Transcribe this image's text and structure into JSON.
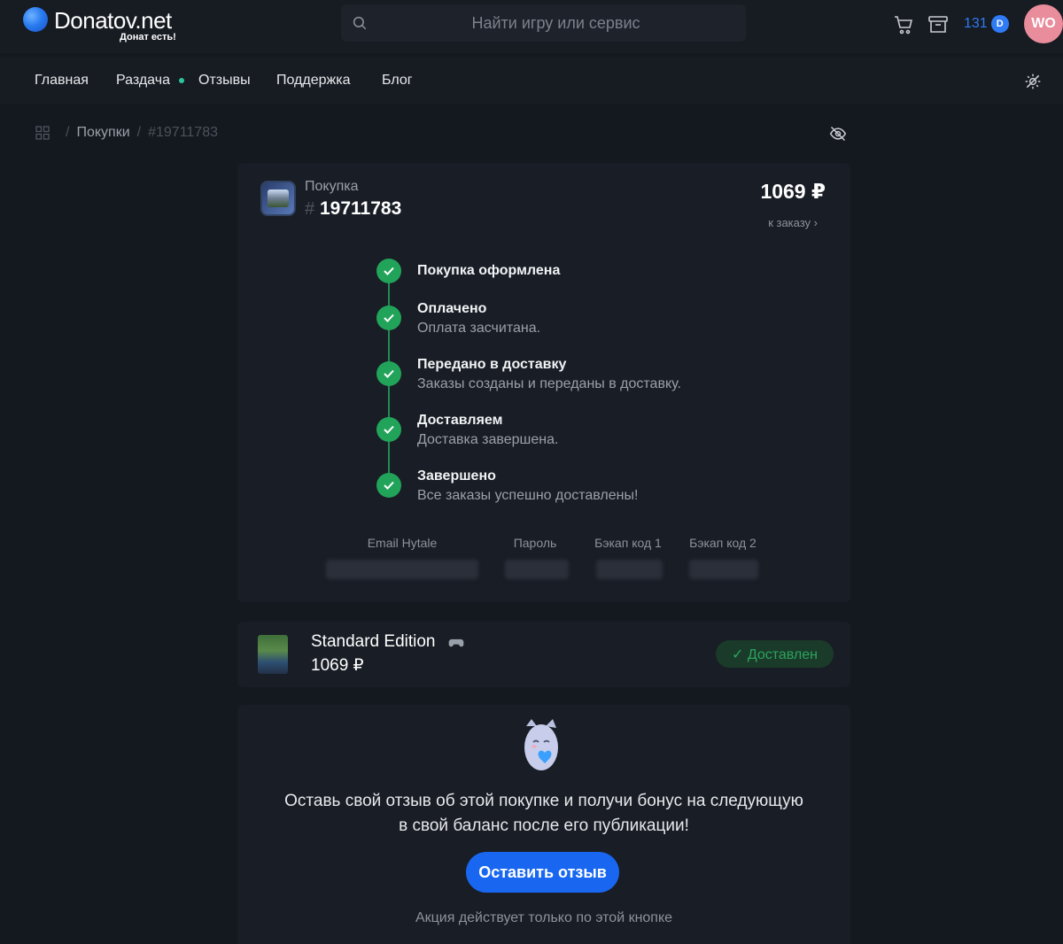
{
  "header": {
    "logo_name": "Donatov.net",
    "logo_tagline": "Донат есть!",
    "search_placeholder": "Найти игру или сервис",
    "balance": "131",
    "coin_symbol": "D",
    "avatar_initials": "WO"
  },
  "nav": {
    "items": [
      "Главная",
      "Раздача",
      "Отзывы",
      "Поддержка",
      "Блог"
    ]
  },
  "breadcrumb": {
    "section": "Покупки",
    "current": "#19711783",
    "separator": "/"
  },
  "order": {
    "kicker": "Покупка",
    "hash": "#",
    "number": "19711783",
    "total": "1069 ₽",
    "to_order_link": "к заказу ›",
    "steps": [
      {
        "title": "Покупка оформлена",
        "desc": ""
      },
      {
        "title": "Оплачено",
        "desc": "Оплата засчитана."
      },
      {
        "title": "Передано в доставку",
        "desc": "Заказы созданы и переданы в доставку."
      },
      {
        "title": "Доставляем",
        "desc": "Доставка завершена."
      },
      {
        "title": "Завершено",
        "desc": "Все заказы успешно доставлены!"
      }
    ],
    "credentials": [
      "Email Hytale",
      "Пароль",
      "Бэкап код 1",
      "Бэкап код 2"
    ]
  },
  "item": {
    "name": "Standard Edition",
    "price": "1069 ₽",
    "status": "✓ Доставлен"
  },
  "review": {
    "text_line1": "Оставь свой отзыв об этой покупке и получи бонус на следующую",
    "text_line2": "в свой баланс после его публикации!",
    "button_label": "Оставить отзыв",
    "note": "Акция действует только по этой кнопке"
  },
  "colors": {
    "background": "#14181f",
    "card": "#191d25",
    "accent_blue": "#1967f0",
    "success_green": "#22a35a",
    "avatar_pink": "#e98c9b"
  }
}
